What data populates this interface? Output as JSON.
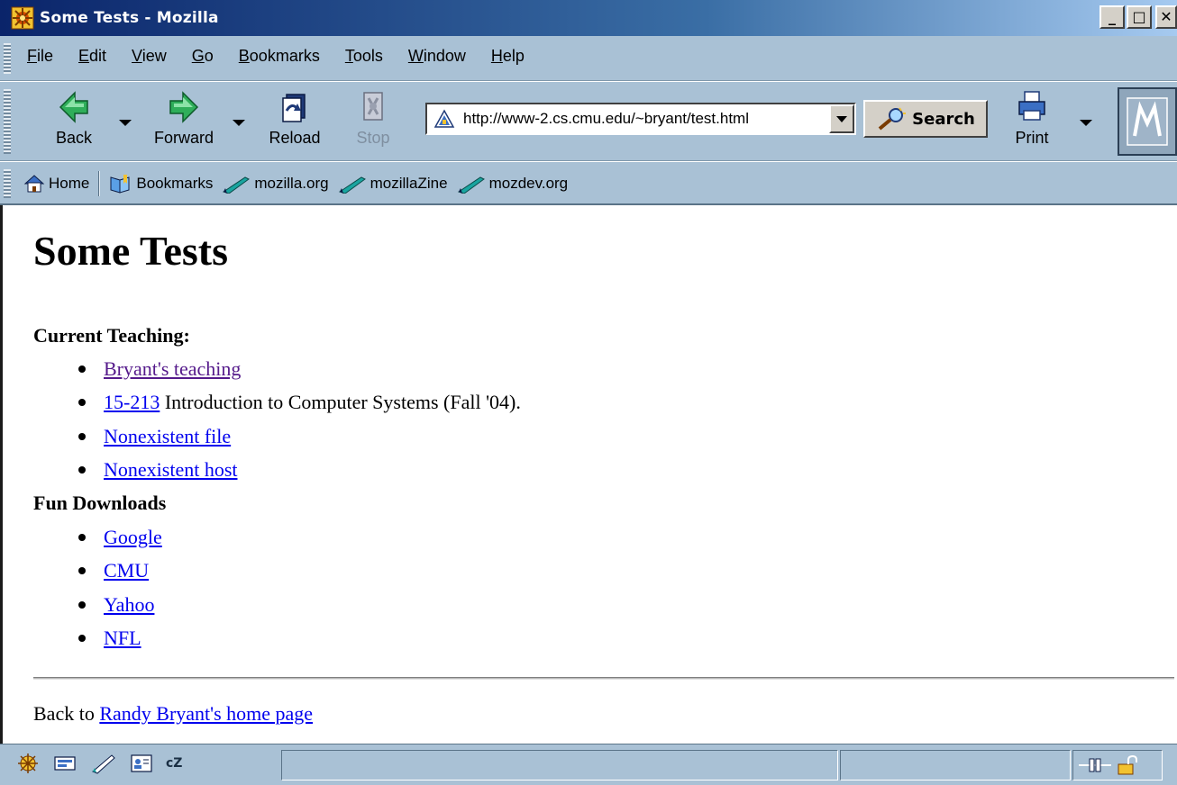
{
  "window": {
    "title": "Some Tests - Mozilla",
    "minimize": "_",
    "maximize": "□",
    "close": "✕"
  },
  "menu": {
    "items": [
      {
        "acc": "F",
        "rest": "ile"
      },
      {
        "acc": "E",
        "rest": "dit"
      },
      {
        "acc": "V",
        "rest": "iew"
      },
      {
        "acc": "G",
        "rest": "o"
      },
      {
        "acc": "B",
        "rest": "ookmarks"
      },
      {
        "acc": "T",
        "rest": "ools"
      },
      {
        "acc": "W",
        "rest": "indow"
      },
      {
        "acc": "H",
        "rest": "elp"
      }
    ]
  },
  "navigation": {
    "back": "Back",
    "forward": "Forward",
    "reload": "Reload",
    "stop": "Stop",
    "url": "http://www-2.cs.cmu.edu/~bryant/test.html",
    "search": "Search",
    "print": "Print"
  },
  "personal_toolbar": {
    "home": "Home",
    "bookmarks": "Bookmarks",
    "links": [
      "mozilla.org",
      "mozillaZine",
      "mozdev.org"
    ]
  },
  "page": {
    "heading": "Some Tests",
    "current_teaching": {
      "title": "Current Teaching:",
      "items": [
        {
          "link": "Bryant's teaching",
          "text": ""
        },
        {
          "link": "15-213",
          "text": " Introduction to Computer Systems (Fall '04)."
        },
        {
          "link": "Nonexistent file",
          "text": ""
        },
        {
          "link": "Nonexistent host",
          "text": ""
        }
      ]
    },
    "fun_downloads": {
      "title": "Fun Downloads",
      "items": [
        "Google",
        "CMU",
        "Yahoo",
        "NFL"
      ]
    },
    "back_prefix": "Back to ",
    "back_link": "Randy Bryant's home page"
  },
  "status": {
    "icons": [
      "navigator-icon",
      "mail-icon",
      "composer-icon",
      "address-book-icon",
      "chatzilla-icon"
    ],
    "chatzilla_label": "cZ",
    "message": ""
  },
  "colors": {
    "toolbar": "#a9c1d5",
    "link": "#0000ee",
    "visited": "#551a8b"
  }
}
